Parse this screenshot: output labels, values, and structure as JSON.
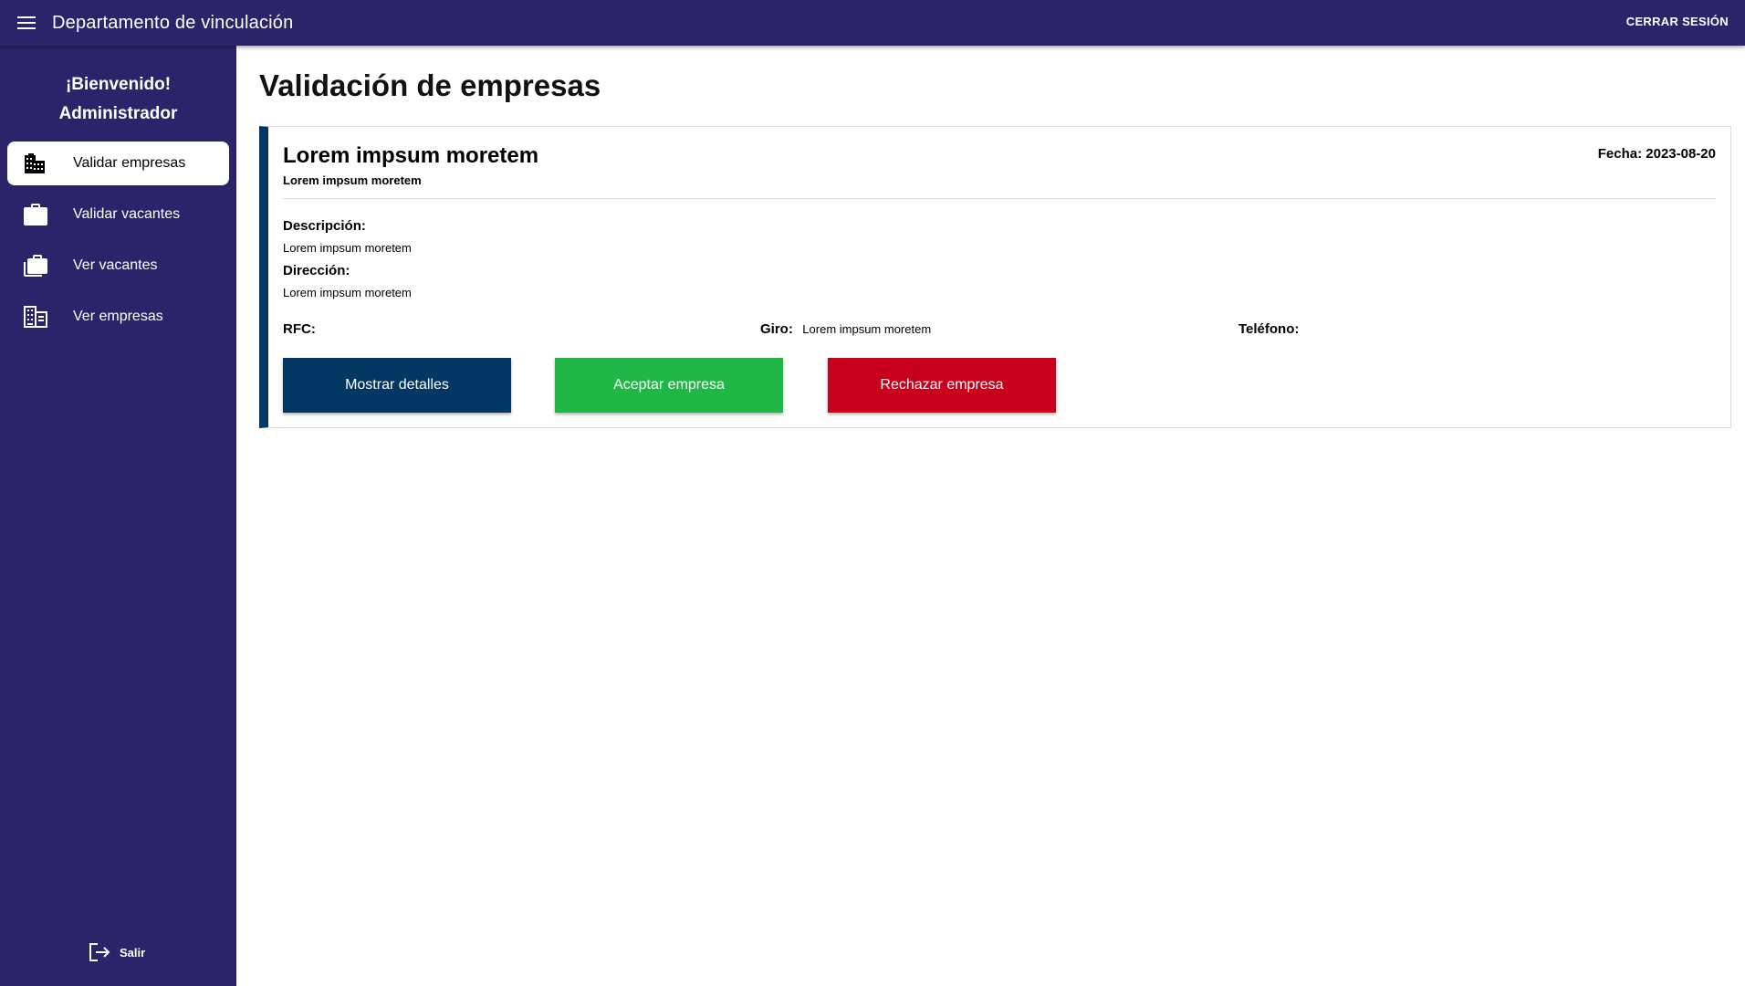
{
  "header": {
    "title": "Departamento de vinculación",
    "logout_label": "CERRAR SESIÓN",
    "menu_icon": "menu-icon"
  },
  "sidebar": {
    "welcome_line1": "¡Bienvenido!",
    "welcome_line2": "Administrador",
    "items": [
      {
        "label": "Validar empresas",
        "icon": "buildings-icon",
        "active": true
      },
      {
        "label": "Validar vacantes",
        "icon": "briefcase-icon",
        "active": false
      },
      {
        "label": "Ver vacantes",
        "icon": "briefcases-icon",
        "active": false
      },
      {
        "label": "Ver empresas",
        "icon": "building-list-icon",
        "active": false
      }
    ],
    "exit_label": "Salir",
    "exit_icon": "logout-icon"
  },
  "main": {
    "title": "Validación de empresas",
    "card": {
      "company_name": "Lorem impsum moretem",
      "company_subtitle": "Lorem impsum moretem",
      "date_text": "Fecha: 2023-08-20",
      "description_label": "Descripción:",
      "description_value": "Lorem impsum moretem",
      "address_label": "Dirección:",
      "address_value": "Lorem impsum moretem",
      "rfc_label": "RFC:",
      "rfc_value": "",
      "giro_label": "Giro:",
      "giro_value": "Lorem impsum moretem",
      "phone_label": "Teléfono:",
      "phone_value": "",
      "buttons": {
        "details": "Mostrar detalles",
        "accept": "Aceptar empresa",
        "reject": "Rechazar empresa"
      }
    }
  },
  "colors": {
    "primary": "#2c246a",
    "card_accent": "#033763",
    "accept": "#21b746",
    "reject": "#c8001e"
  }
}
